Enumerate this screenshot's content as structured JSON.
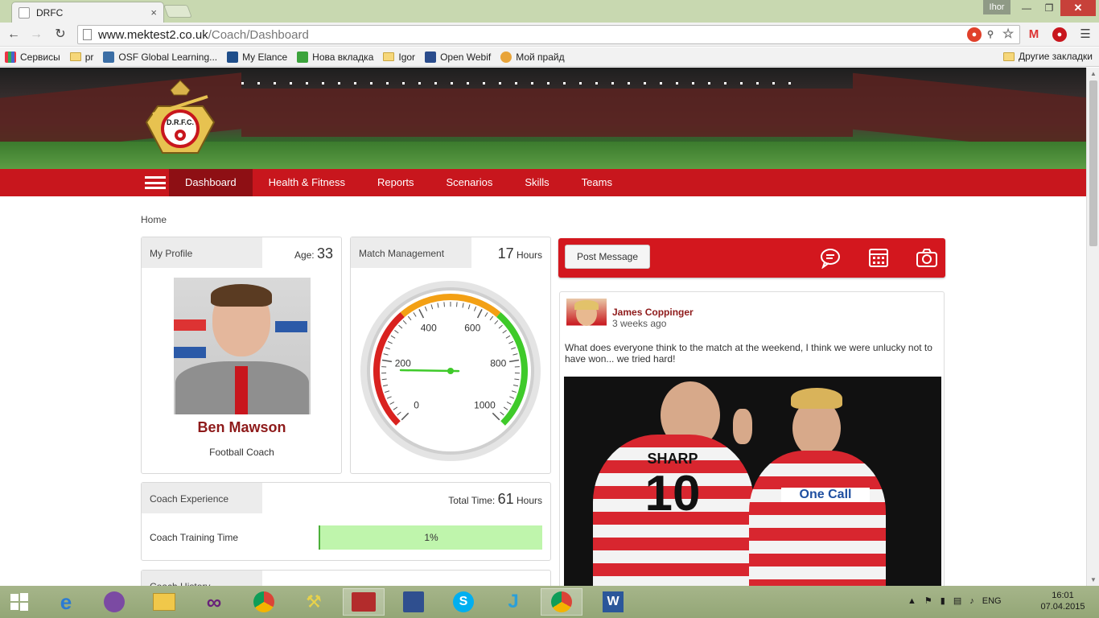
{
  "browser": {
    "tab_title": "DRFC",
    "tab_close": "×",
    "user_badge": "Ihor",
    "url_host": "www.mektest2.co.uk",
    "url_path": "/Coach/Dashboard",
    "bookmarks": [
      "Сервисы",
      "pr",
      "OSF Global Learning...",
      "My Elance",
      "Нова вкладка",
      "Igor",
      "Open Webif",
      "Мой прайд"
    ],
    "other_bookmarks": "Другие закладки"
  },
  "nav": {
    "items": [
      "Dashboard",
      "Health & Fitness",
      "Reports",
      "Scenarios",
      "Skills",
      "Teams"
    ],
    "active": "Dashboard"
  },
  "breadcrumb": "Home",
  "profile": {
    "heading": "My Profile",
    "age_label": "Age:",
    "age": "33",
    "name": "Ben Mawson",
    "role": "Football Coach"
  },
  "match": {
    "heading": "Match Management",
    "hours": "17",
    "hours_unit": "Hours",
    "gauge": {
      "min": 0,
      "max": 1000,
      "value": 170,
      "ticks": [
        "0",
        "200",
        "400",
        "600",
        "800",
        "1000"
      ],
      "colors": {
        "red": "#d9221f",
        "orange": "#f3a014",
        "green": "#3fca2a",
        "needle": "#3fca2a"
      }
    }
  },
  "experience": {
    "heading": "Coach Experience",
    "total_label": "Total Time:",
    "total": "61",
    "total_unit": "Hours",
    "row_label": "Coach Training Time",
    "progress_text": "1%",
    "progress_value": 0.01
  },
  "history": {
    "heading": "Coach History"
  },
  "feed": {
    "post_button": "Post Message",
    "icons": [
      "chat-icon",
      "calendar-icon",
      "camera-icon"
    ],
    "post": {
      "author": "James Coppinger",
      "ago": "3 weeks ago",
      "text": "What does everyone think to the match at the weekend, I think we were unlucky not to have won... we tried hard!",
      "shirt_left_name": "SHARP",
      "shirt_left_number": "10",
      "shirt_right_sponsor": "One Call"
    }
  },
  "taskbar": {
    "lang": "ENG",
    "time": "16:01",
    "date": "07.04.2015"
  },
  "colors": {
    "brand_red": "#c8161d",
    "brand_dark_red": "#8e0f14",
    "name_red": "#8e1a1a",
    "progress_green": "#bff5ac"
  }
}
